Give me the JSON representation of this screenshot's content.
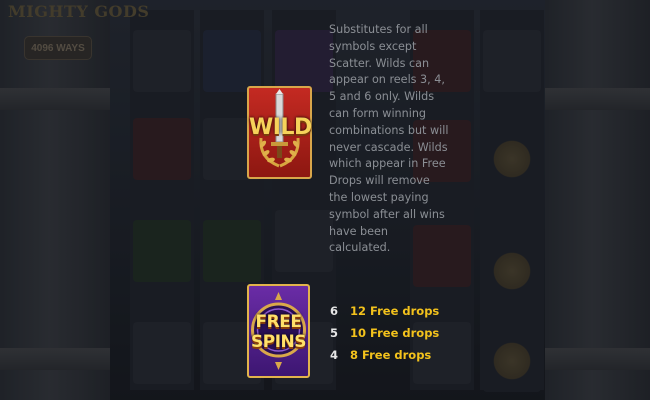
{
  "game": {
    "title": "MIGHTY GODS",
    "ways_badge": "4096 WAYS"
  },
  "paytable": {
    "wild": {
      "icon": "wild-symbol",
      "symbol_text": "WILD",
      "description": "Substitutes for all symbols except Scatter. Wilds can appear on reels 3, 4, 5 and 6 only. Wilds can form winning combinations but will never cascade. Wilds which appear in Free Drops will remove the lowest paying symbol after all wins have been calculated."
    },
    "scatter": {
      "icon": "free-spins-symbol",
      "symbol_line1": "FREE",
      "symbol_line2": "SPINS",
      "payouts": [
        {
          "count": "6",
          "reward": "12 Free drops"
        },
        {
          "count": "5",
          "reward": "10 Free drops"
        },
        {
          "count": "4",
          "reward": "8 Free drops"
        }
      ]
    }
  },
  "colors": {
    "reward_text": "#f3c21c",
    "description_text": "#8b8f95",
    "count_text": "#e7e7e7"
  }
}
